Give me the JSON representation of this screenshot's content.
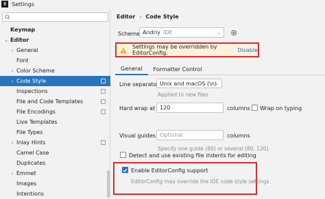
{
  "window": {
    "title": "Settings",
    "app_icon_text": "IJ"
  },
  "sidebar": {
    "search_placeholder": "",
    "items": [
      {
        "label": "Keymap",
        "bold": true
      },
      {
        "label": "Editor",
        "bold": true,
        "expanded": true
      },
      {
        "label": "General",
        "collapsed": true
      },
      {
        "label": "Font"
      },
      {
        "label": "Color Scheme",
        "collapsed": true
      },
      {
        "label": "Code Style",
        "selected": true,
        "expanded": true
      },
      {
        "label": "Inspections"
      },
      {
        "label": "File and Code Templates"
      },
      {
        "label": "File Encodings"
      },
      {
        "label": "Live Templates"
      },
      {
        "label": "File Types"
      },
      {
        "label": "Inlay Hints",
        "collapsed": true
      },
      {
        "label": "Camel Case"
      },
      {
        "label": "Duplicates"
      },
      {
        "label": "Emmet",
        "collapsed": true
      },
      {
        "label": "Images"
      },
      {
        "label": "Intentions"
      }
    ]
  },
  "breadcrumb": {
    "first": "Editor",
    "separator": "›",
    "second": "Code Style"
  },
  "scheme": {
    "label": "Scheme:",
    "value": "Andriy",
    "tag": "IDE"
  },
  "warning": {
    "text": "Settings may be overridden by EditorConfig.",
    "link": "Disable"
  },
  "tabs": [
    {
      "label": "General",
      "active": true
    },
    {
      "label": "Formatter Control",
      "active": false
    }
  ],
  "line_separator": {
    "label": "Line separator:",
    "value": "Unix and macOS (\\n)",
    "hint": "Applied to new files"
  },
  "hard_wrap": {
    "label": "Hard wrap at",
    "value": "120",
    "unit": "columns",
    "wrap_label": "Wrap on typing",
    "wrap_checked": false
  },
  "visual_guides": {
    "label": "Visual guides:",
    "placeholder": "Optional",
    "unit": "columns",
    "hint": "Specify one guide (80) or several (80, 120)"
  },
  "detect_indents": {
    "label": "Detect and use existing file indents for editing",
    "checked": false
  },
  "editorconfig": {
    "label": "Enable EditorConfig support",
    "checked": true,
    "hint": "EditorConfig may override the IDE code style settings"
  },
  "colors": {
    "accent": "#2675bf",
    "highlight_border": "#d62b2b",
    "warning_bg": "#fbf1dc",
    "link": "#2a6ec2"
  }
}
